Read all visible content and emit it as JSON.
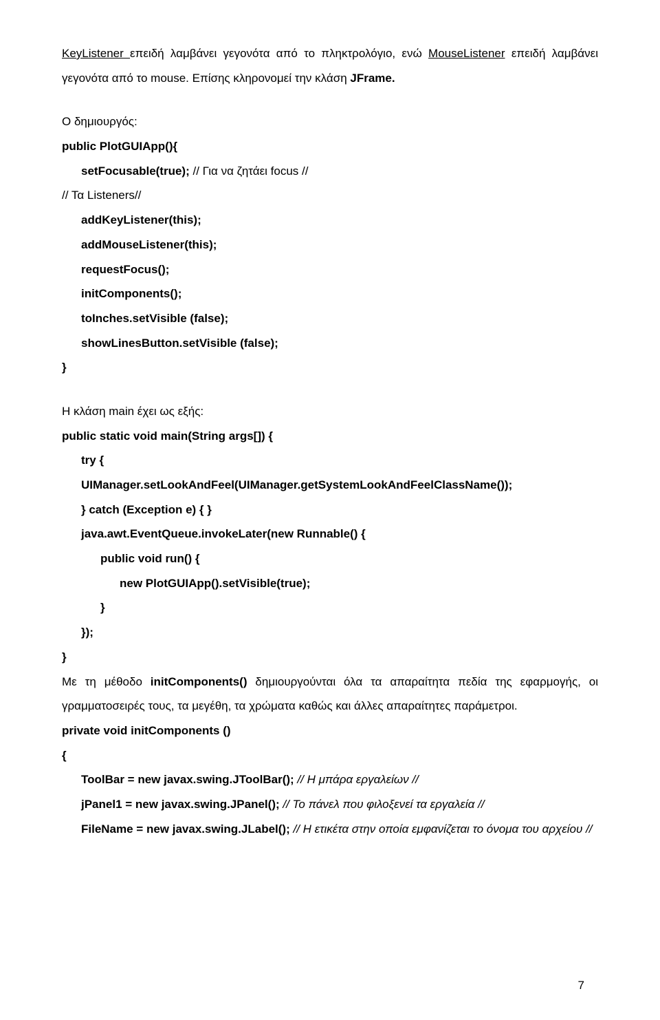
{
  "para1": {
    "seg1": "KeyListener ",
    "seg2": "επειδή λαμβάνει γεγονότα από το πληκτρολόγιο, ενώ ",
    "seg3": "MouseListener",
    "seg4": " επειδή λαμβάνει γεγονότα από το mouse. Επίσης κληρονομεί την κλάση ",
    "seg5": "JFrame.",
    "seg6": ""
  },
  "constructor_intro": "Ο δημιουργός:",
  "constructor": {
    "l1": "public PlotGUIApp(){",
    "l2_a": "setFocusable(true);",
    "l2_b": " // Για να ζητάει focus //",
    "l3": "// Τα Listeners//",
    "l4": "addKeyListener(this);",
    "l5": "addMouseListener(this);",
    "l6": "requestFocus();",
    "l7": "initComponents();",
    "l8": "toInches.setVisible (false);",
    "l9": "showLinesButton.setVisible (false);",
    "l10": "}"
  },
  "main_intro": "Η κλάση main έχει ως εξής:",
  "main": {
    "l1": "public static void main(String args[]) {",
    "l2": "try {",
    "l3": "UIManager.setLookAndFeel(UIManager.getSystemLookAndFeelClassName());",
    "l4": "} catch (Exception e) { }",
    "l5": "java.awt.EventQueue.invokeLater(new Runnable() {",
    "l6": "public void run() {",
    "l7": "new PlotGUIApp().setVisible(true);",
    "l8": "}",
    "l9": "});",
    "l10": "}"
  },
  "after_main_para": {
    "seg1": "Με τη μέθοδο ",
    "seg2": "initComponents()",
    "seg3": " δημιουργούνται όλα τα απαραίτητα πεδία της εφαρμογής, οι γραμματοσειρές τους, τα μεγέθη, τα χρώματα καθώς και άλλες απαραίτητες παράμετροι."
  },
  "init": {
    "l1": "private void initComponents ()",
    "l2": "{",
    "l3_a": "ToolBar = new javax.swing.JToolBar();",
    "l3_b": " // Η μπάρα εργαλείων //",
    "l4_a": "jPanel1 = new javax.swing.JPanel();",
    "l4_b": " // Το πάνελ που φιλοξενεί τα εργαλεία //",
    "l5_a": "FileName = new javax.swing.JLabel();",
    "l5_b": " // Η ετικέτα στην οποία εμφανίζεται το όνομα του αρχείου //"
  },
  "page_number": "7"
}
